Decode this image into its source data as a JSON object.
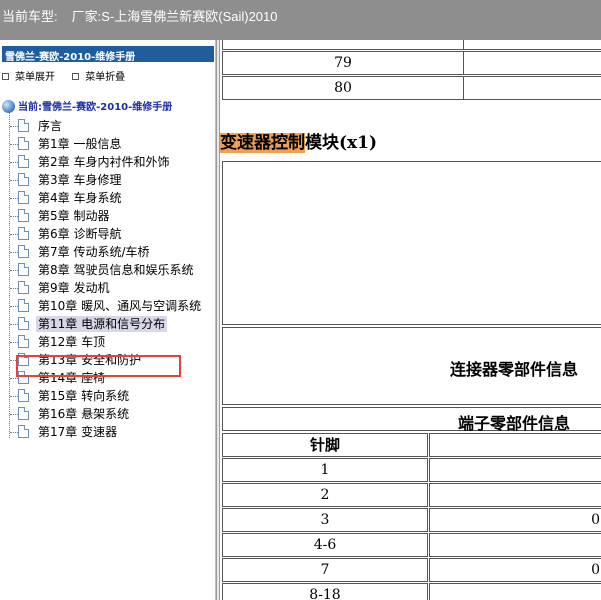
{
  "window": {
    "current_model_label": "当前车型:",
    "manufacturer": "厂家:S-上海雪佛兰新赛欧(Sail)2010"
  },
  "sidebar": {
    "header": "雪佛兰-赛欧-2010-维修手册",
    "expand_label": "菜单展开",
    "collapse_label": "菜单折叠",
    "root_label": "当前:雪佛兰-赛欧-2010-维修手册",
    "items": [
      "序言",
      "第1章 一般信息",
      "第2章 车身内衬件和外饰",
      "第3章 车身修理",
      "第4章 车身系统",
      "第5章 制动器",
      "第6章 诊断导航",
      "第7章 传动系统/车桥",
      "第8章 驾驶员信息和娱乐系统",
      "第9章 发动机",
      "第10章 暖风、通风与空调系统",
      "第11章 电源和信号分布",
      "第12章 车顶",
      "第13章 安全和防护",
      "第14章 座椅",
      "第15章 转向系统",
      "第16章 悬架系统",
      "第17章 变速器"
    ],
    "selected_index": 11
  },
  "content": {
    "top_rows": [
      "79",
      "80"
    ],
    "module_title_highlight": "变速器控制",
    "module_title_rest": "模块(x1)",
    "connector_info": "连接器零部件信息",
    "terminal_info": "端子零部件信息",
    "pin_header": "针脚",
    "pins": [
      "1",
      "2",
      "3",
      "4-6",
      "7",
      "8-18"
    ],
    "pin_right_values": [
      "",
      "",
      "0",
      "",
      "0",
      ""
    ]
  }
}
